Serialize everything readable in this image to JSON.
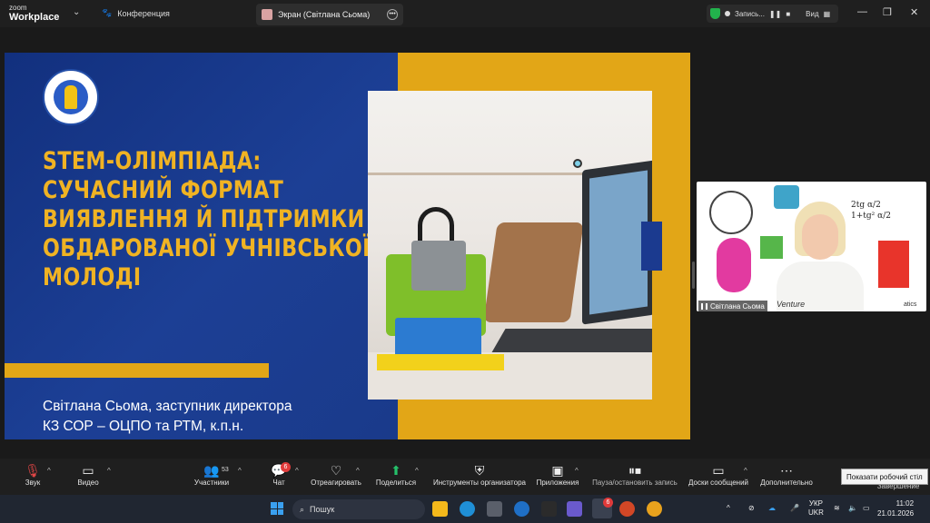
{
  "titlebar": {
    "brand_small": "zoom",
    "brand_big": "Workplace",
    "conference_label": "Конференция",
    "screen_tab_label": "Экран (Світлана Сьома)",
    "record_label": "Запись...",
    "view_label": "Вид"
  },
  "slide": {
    "title_lines": [
      "STEM-ОЛІМПІАДА:",
      "СУЧАСНИЙ ФОРМАТ",
      "ВИЯВЛЕННЯ Й ПІДТРИМКИ",
      "ОБДАРОВАНОЇ УЧНІВСЬКОЇ",
      "МОЛОДІ"
    ],
    "author_line1": "Світлана Сьома, заступник директора",
    "author_line2": "КЗ СОР – ОЦПО та РТМ, к.п.н."
  },
  "video": {
    "participant_name": "Світлана Сьома",
    "shirt_text": "Venture",
    "formula_line1": "2tg α/2",
    "formula_line2": "1+tg² α/2",
    "corner_text": "atics"
  },
  "toolbar": {
    "audio": "Звук",
    "video": "Видео",
    "participants": "Участники",
    "participants_count": "53",
    "chat": "Чат",
    "chat_badge": "6",
    "react": "Отреагировать",
    "share": "Поделиться",
    "host_tools": "Инструменты организатора",
    "apps": "Приложения",
    "pause_record": "Пауза/остановить запись",
    "whiteboards": "Доски сообщений",
    "more": "Дополнительно",
    "end": "Завершение",
    "tooltip": "Показати робочий стіл"
  },
  "taskbar": {
    "search_placeholder": "Пошук",
    "lang1": "УКР",
    "lang2": "UKR",
    "time": "11:02",
    "date": "21.01.2026",
    "app_badge": "6"
  }
}
